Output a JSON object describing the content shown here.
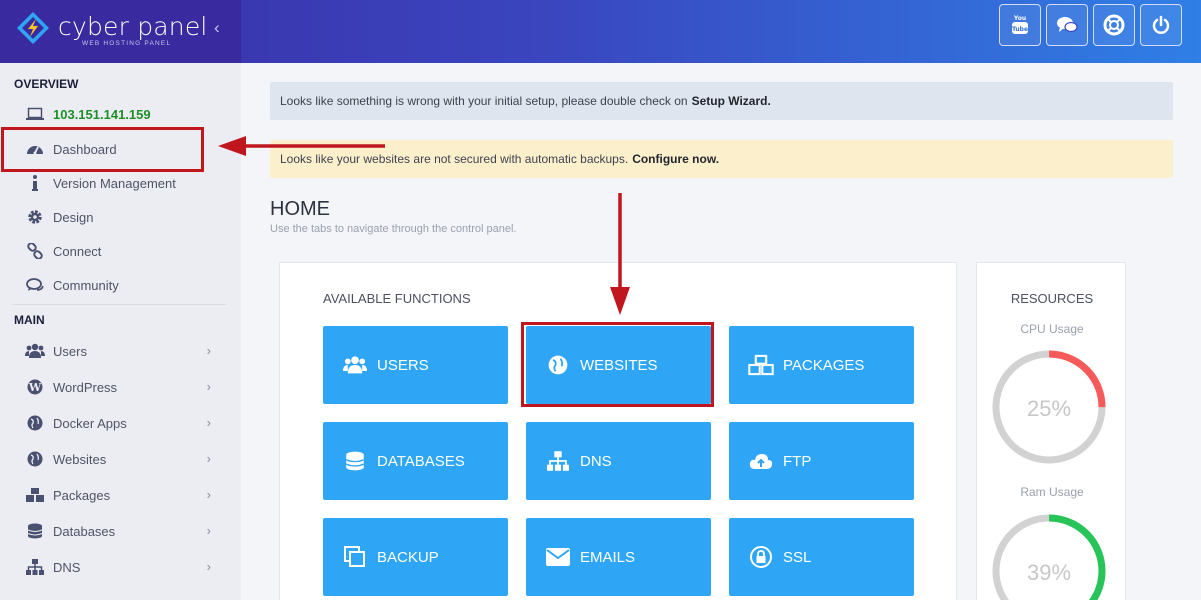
{
  "brand": {
    "name": "cyber panel",
    "subtitle": "WEB HOSTING PANEL"
  },
  "topbar": {
    "icons": [
      "youtube-icon",
      "chat-icon",
      "support-icon",
      "power-icon"
    ],
    "youtube_label": "You Tube"
  },
  "sidebar": {
    "overview_title": "OVERVIEW",
    "ip": "103.151.141.159",
    "overview_items": [
      {
        "label": "Dashboard",
        "icon": "dashboard-icon"
      },
      {
        "label": "Version Management",
        "icon": "info-icon"
      },
      {
        "label": "Design",
        "icon": "gear-icon"
      },
      {
        "label": "Connect",
        "icon": "link-icon"
      },
      {
        "label": "Community",
        "icon": "comments-icon"
      }
    ],
    "main_title": "MAIN",
    "main_items": [
      {
        "label": "Users",
        "icon": "users-icon"
      },
      {
        "label": "WordPress",
        "icon": "wordpress-icon"
      },
      {
        "label": "Docker Apps",
        "icon": "globe-icon"
      },
      {
        "label": "Websites",
        "icon": "globe-icon"
      },
      {
        "label": "Packages",
        "icon": "cubes-icon"
      },
      {
        "label": "Databases",
        "icon": "database-icon"
      },
      {
        "label": "DNS",
        "icon": "sitemap-icon"
      }
    ]
  },
  "alerts": {
    "setup_text": "Looks like something is wrong with your initial setup, please double check on",
    "setup_link": "Setup Wizard.",
    "backup_text": "Looks like your websites are not secured with automatic backups.",
    "backup_link": "Configure now."
  },
  "home": {
    "title": "HOME",
    "subtitle": "Use the tabs to navigate through the control panel."
  },
  "functions": {
    "title": "AVAILABLE FUNCTIONS",
    "items": [
      {
        "label": "USERS",
        "icon": "users-icon"
      },
      {
        "label": "WEBSITES",
        "icon": "globe-icon"
      },
      {
        "label": "PACKAGES",
        "icon": "cubes-icon"
      },
      {
        "label": "DATABASES",
        "icon": "database-icon"
      },
      {
        "label": "DNS",
        "icon": "sitemap-icon"
      },
      {
        "label": "FTP",
        "icon": "cloud-upload-icon"
      },
      {
        "label": "BACKUP",
        "icon": "copy-icon"
      },
      {
        "label": "EMAILS",
        "icon": "envelope-icon"
      },
      {
        "label": "SSL",
        "icon": "lock-icon"
      }
    ]
  },
  "resources": {
    "title": "RESOURCES",
    "cpu": {
      "label": "CPU Usage",
      "value": 25,
      "display": "25%",
      "color": "#f65a5a"
    },
    "ram": {
      "label": "Ram Usage",
      "value": 39,
      "display": "39%",
      "color": "#27c45a"
    }
  },
  "colors": {
    "accent": "#2fa6f5",
    "annotation": "#c0161e",
    "ip": "#1c8f27"
  }
}
